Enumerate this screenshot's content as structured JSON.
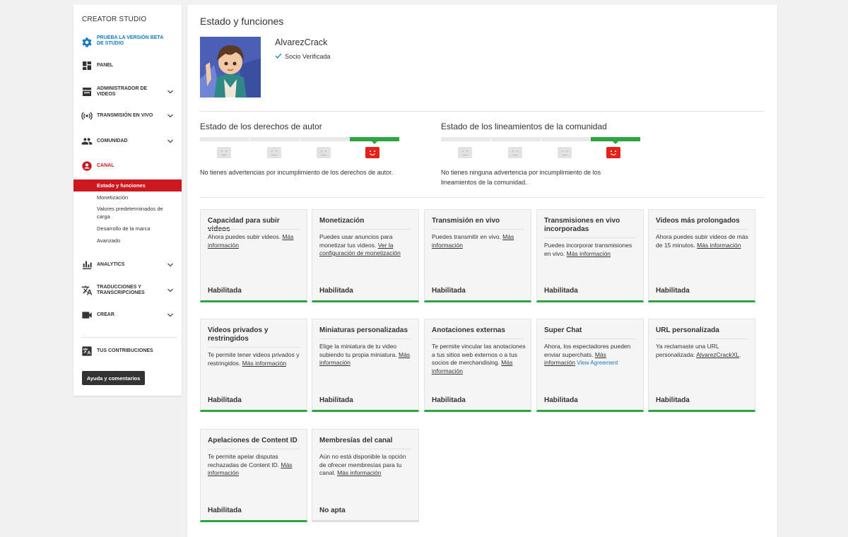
{
  "sidebar": {
    "title": "CREATOR STUDIO",
    "items": [
      {
        "label": "PRUEBA LA VERSIÓN BETA DE STUDIO",
        "icon": "gear-icon"
      },
      {
        "label": "PANEL",
        "icon": "dashboard-icon"
      },
      {
        "label": "ADMINISTRADOR DE VIDEOS",
        "icon": "video-manager-icon"
      },
      {
        "label": "TRANSMISIÓN EN VIVO",
        "icon": "live-icon"
      },
      {
        "label": "COMUNIDAD",
        "icon": "community-icon"
      },
      {
        "label": "CANAL",
        "icon": "channel-icon"
      },
      {
        "label": "ANALYTICS",
        "icon": "analytics-icon"
      },
      {
        "label": "TRADUCCIONES Y TRANSCRIPCIONES",
        "icon": "translate-icon"
      },
      {
        "label": "CREAR",
        "icon": "camera-icon"
      },
      {
        "label": "TUS CONTRIBUCIONES",
        "icon": "contributions-icon"
      }
    ],
    "channel_sub": [
      "Estado y funciones",
      "Monetización",
      "Valores predeterminados de carga",
      "Desarrollo de la marca",
      "Avanzado"
    ],
    "help_button": "Ayuda y comentarios"
  },
  "main": {
    "title": "Estado y funciones",
    "channel_name": "AlvarezCrack",
    "verified_label": "Socio Verificada",
    "copyright": {
      "title": "Estado de los derechos de autor",
      "text": "No tienes advertencias por incumplimiento de los derechos de autor."
    },
    "community": {
      "title": "Estado de los lineamientos de la comunidad",
      "text1": "No tienes ninguna advertencia por incumplimiento de los",
      "text2": "lineamientos de la comunidad."
    },
    "cards": [
      {
        "title": "Capacidad para subir videos",
        "desc": "Ahora puedes subir videos.",
        "link": "Más información",
        "status": "Habilitada"
      },
      {
        "title": "Monetización",
        "desc": "Puedes usar anuncios para monetizar tus videos.",
        "link": "Ver la configuración de monetización",
        "status": "Habilitada"
      },
      {
        "title": "Transmisión en vivo",
        "desc": "Puedes transmitir en vivo.",
        "link": "Más información",
        "status": "Habilitada"
      },
      {
        "title": "Transmisiones en vivo incorporadas",
        "desc": "Puedes incorporar transmisiones en vivo.",
        "link": "Más información",
        "status": "Habilitada"
      },
      {
        "title": "Videos más prolongados",
        "desc": "Ahora puedes subir videos de más de 15 minutos.",
        "link": "Más información",
        "status": "Habilitada"
      },
      {
        "title": "Videos privados y restringidos",
        "desc": "Te permite tener videos privados y restringidos.",
        "link": "Más información",
        "status": "Habilitada"
      },
      {
        "title": "Miniaturas personalizadas",
        "desc": "Elige la miniatura de tu video subiendo tu propia miniatura.",
        "link": "Más información",
        "status": "Habilitada"
      },
      {
        "title": "Anotaciones externas",
        "desc": "Te permite vincular las anotaciones a tus sitios web externos o a tus socios de merchandising.",
        "link": "Más información",
        "status": "Habilitada"
      },
      {
        "title": "Super Chat",
        "desc": "Ahora, los espectadores pueden enviar superchats.",
        "link": "Más información",
        "extra_link": "View Agreement",
        "status": "Habilitada"
      },
      {
        "title": "URL personalizada",
        "desc": "Ya reclamaste una URL personalizada:",
        "link": "AlvarezCrackXL",
        "suffix": ".",
        "status": "Habilitada"
      },
      {
        "title": "Apelaciones de Content ID",
        "desc": "Te permite apelar disputas rechazadas de Content ID.",
        "link": "Más información",
        "status": "Habilitada"
      },
      {
        "title": "Membresías del canal",
        "desc": "Aún no está disponible la opción de ofrecer membresías para tu canal.",
        "link": "Más información",
        "status": "No apta"
      }
    ]
  },
  "colors": {
    "accent_red": "#cc181e",
    "link_blue": "#167ac6",
    "enabled_green": "#2ba640"
  }
}
